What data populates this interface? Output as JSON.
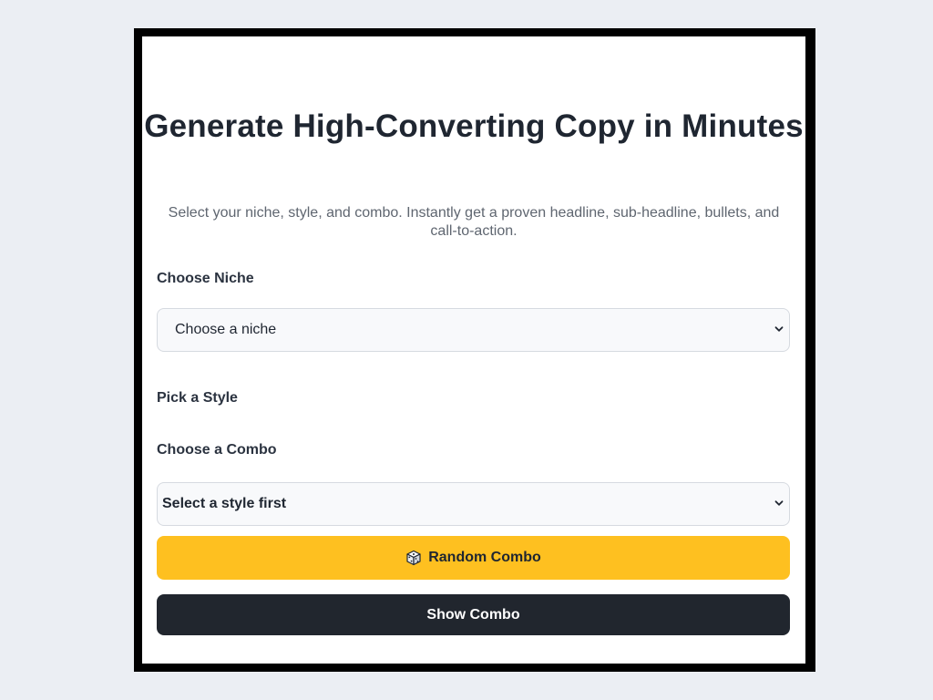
{
  "header": {
    "title": "Generate High-Converting Copy in Minutes",
    "subtitle": "Select your niche, style, and combo. Instantly get a proven headline, sub-headline, bullets, and call-to-action."
  },
  "form": {
    "niche_label": "Choose Niche",
    "niche_select_value": "Choose a niche",
    "style_label": "Pick a Style",
    "combo_label": "Choose a Combo",
    "combo_select_value": "Select a style first"
  },
  "actions": {
    "random_icon": "dice-icon",
    "random_label": "Random Combo",
    "show_label": "Show Combo"
  },
  "colors": {
    "background": "#ebeef3",
    "frame": "#000000",
    "card": "#ffffff",
    "random_button": "#fec020",
    "show_button": "#21262e",
    "title_text": "#1f2631",
    "subtitle_text": "#5f6670"
  }
}
